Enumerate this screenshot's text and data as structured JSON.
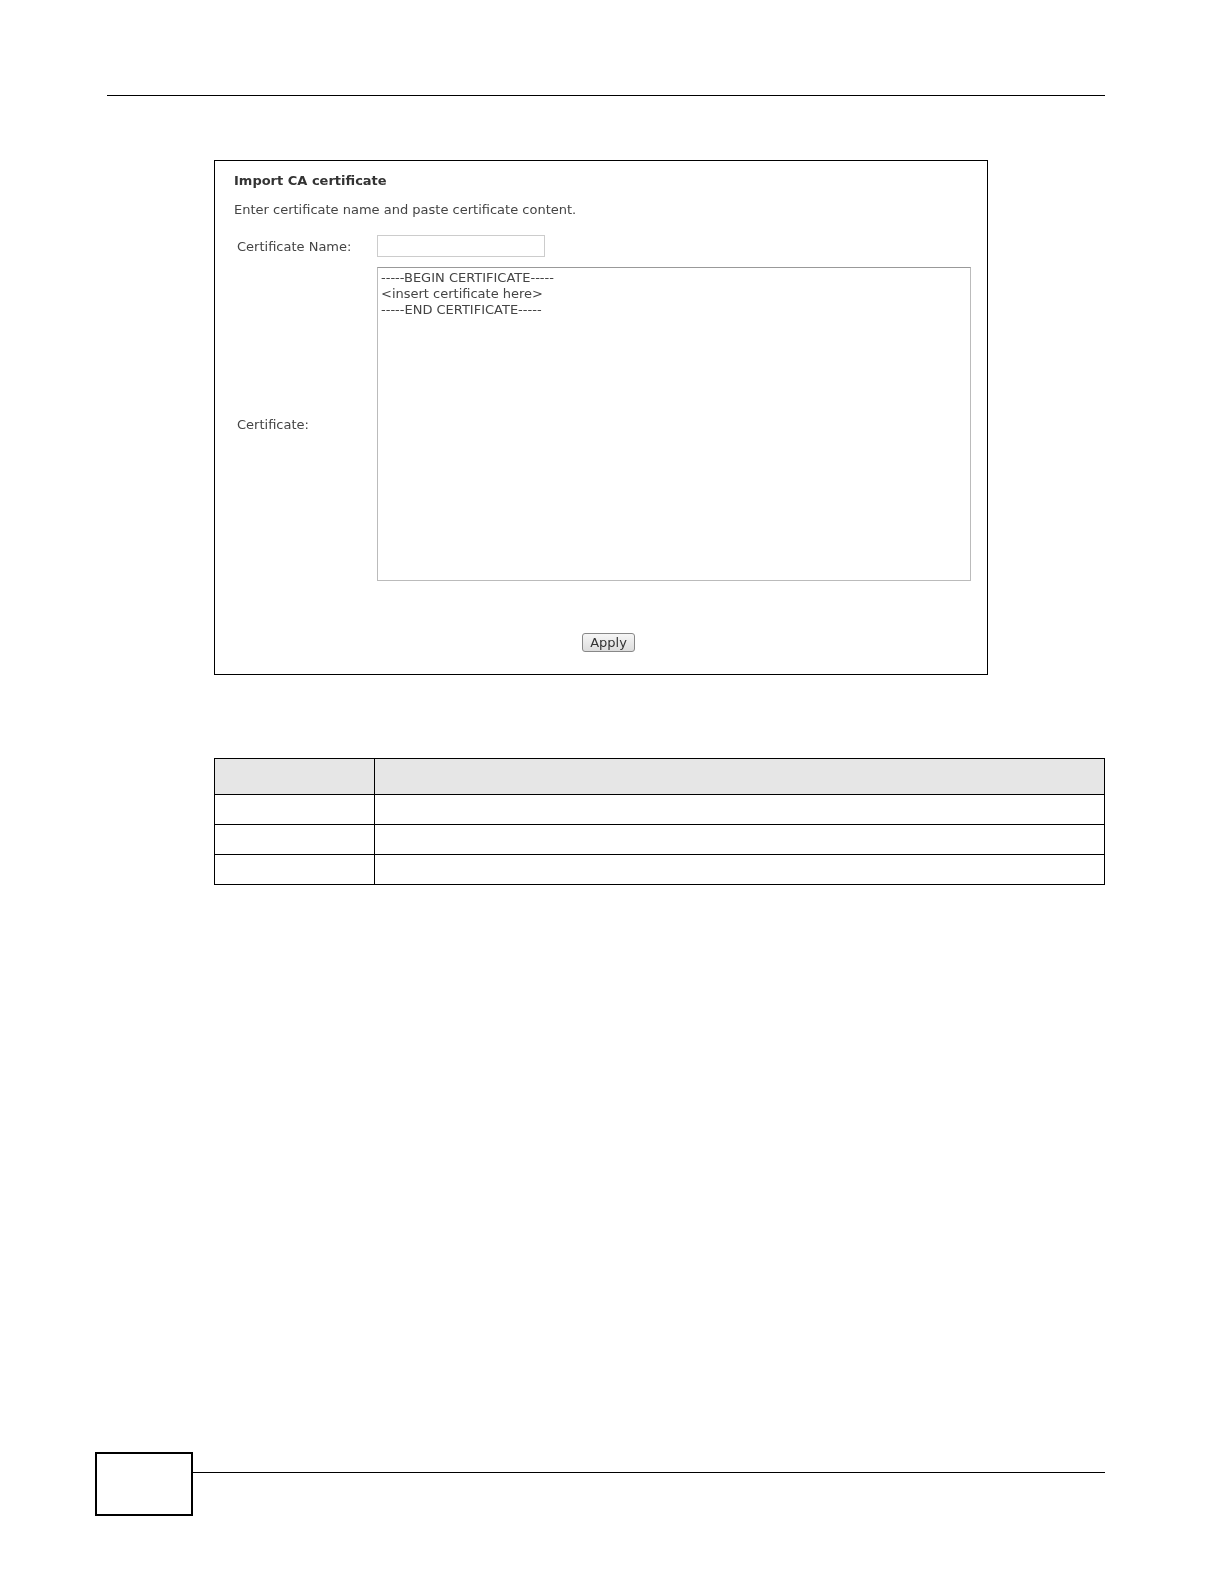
{
  "dialog": {
    "title": "Import CA certificate",
    "instruction": "Enter certificate name and paste certificate content.",
    "name_field": {
      "label": "Certificate Name:"
    },
    "certificate_field": {
      "label": "Certificate:",
      "value": "-----BEGIN CERTIFICATE-----\n<insert certificate here>\n-----END CERTIFICATE-----"
    },
    "buttons": [
      "Apply"
    ]
  }
}
